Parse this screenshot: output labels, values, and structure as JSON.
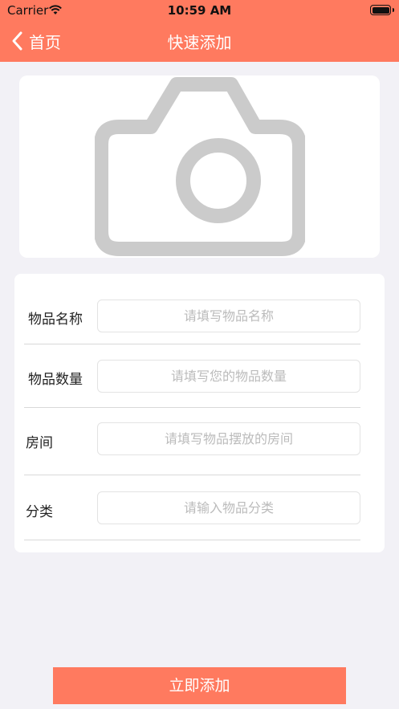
{
  "status_bar": {
    "carrier": "Carrier",
    "time": "10:59 AM"
  },
  "nav": {
    "back_label": "首页",
    "title": "快速添加"
  },
  "form": {
    "fields": [
      {
        "label": "物品名称",
        "placeholder": "请填写物品名称"
      },
      {
        "label": "物品数量",
        "placeholder": "请填写您的物品数量"
      },
      {
        "label": "房间",
        "placeholder": "请填写物品摆放的房间"
      },
      {
        "label": "分类",
        "placeholder": "请输入物品分类"
      }
    ]
  },
  "submit_label": "立即添加",
  "colors": {
    "accent": "#ff7a5f",
    "background": "#f2f1f6",
    "card": "#ffffff",
    "placeholder": "#bbbbbb",
    "camera_gray": "#cbcbcb"
  },
  "icons": {
    "back": "chevron-left-icon",
    "photo": "camera-icon",
    "wifi": "wifi-icon",
    "battery": "battery-icon"
  }
}
